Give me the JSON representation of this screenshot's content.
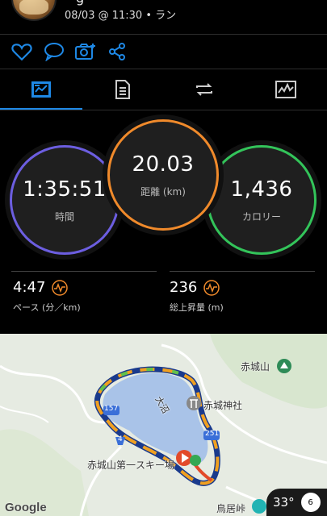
{
  "header": {
    "meta": "08/03 @ 11:30 • ラン",
    "partial_title": "g"
  },
  "actions": [
    "like-icon",
    "comment-icon",
    "add-photo-icon",
    "share-icon"
  ],
  "tabs": [
    "summary-icon",
    "laps-icon",
    "splits-icon",
    "chart-icon"
  ],
  "rings": {
    "time": {
      "value": "1:35:51",
      "label": "時間"
    },
    "distance": {
      "value": "20.03",
      "label": "距離 (km)"
    },
    "calories": {
      "value": "1,436",
      "label": "カロリー"
    }
  },
  "stats": {
    "pace": {
      "value": "4:47",
      "label": "ペース (分／km)"
    },
    "elevation": {
      "value": "236",
      "label": "総上昇量 (m)"
    }
  },
  "map": {
    "labels": {
      "akagi_mountain": "赤城山",
      "akagi_shrine": "赤城神社",
      "lake": "大沼",
      "ski_area": "赤城山第一スキー場",
      "torii_pass": "鳥居峠",
      "route_157": "157",
      "route_251": "251",
      "route_4": "4"
    },
    "google": "Google"
  },
  "weather": {
    "temp": "33°",
    "wind": "6"
  }
}
